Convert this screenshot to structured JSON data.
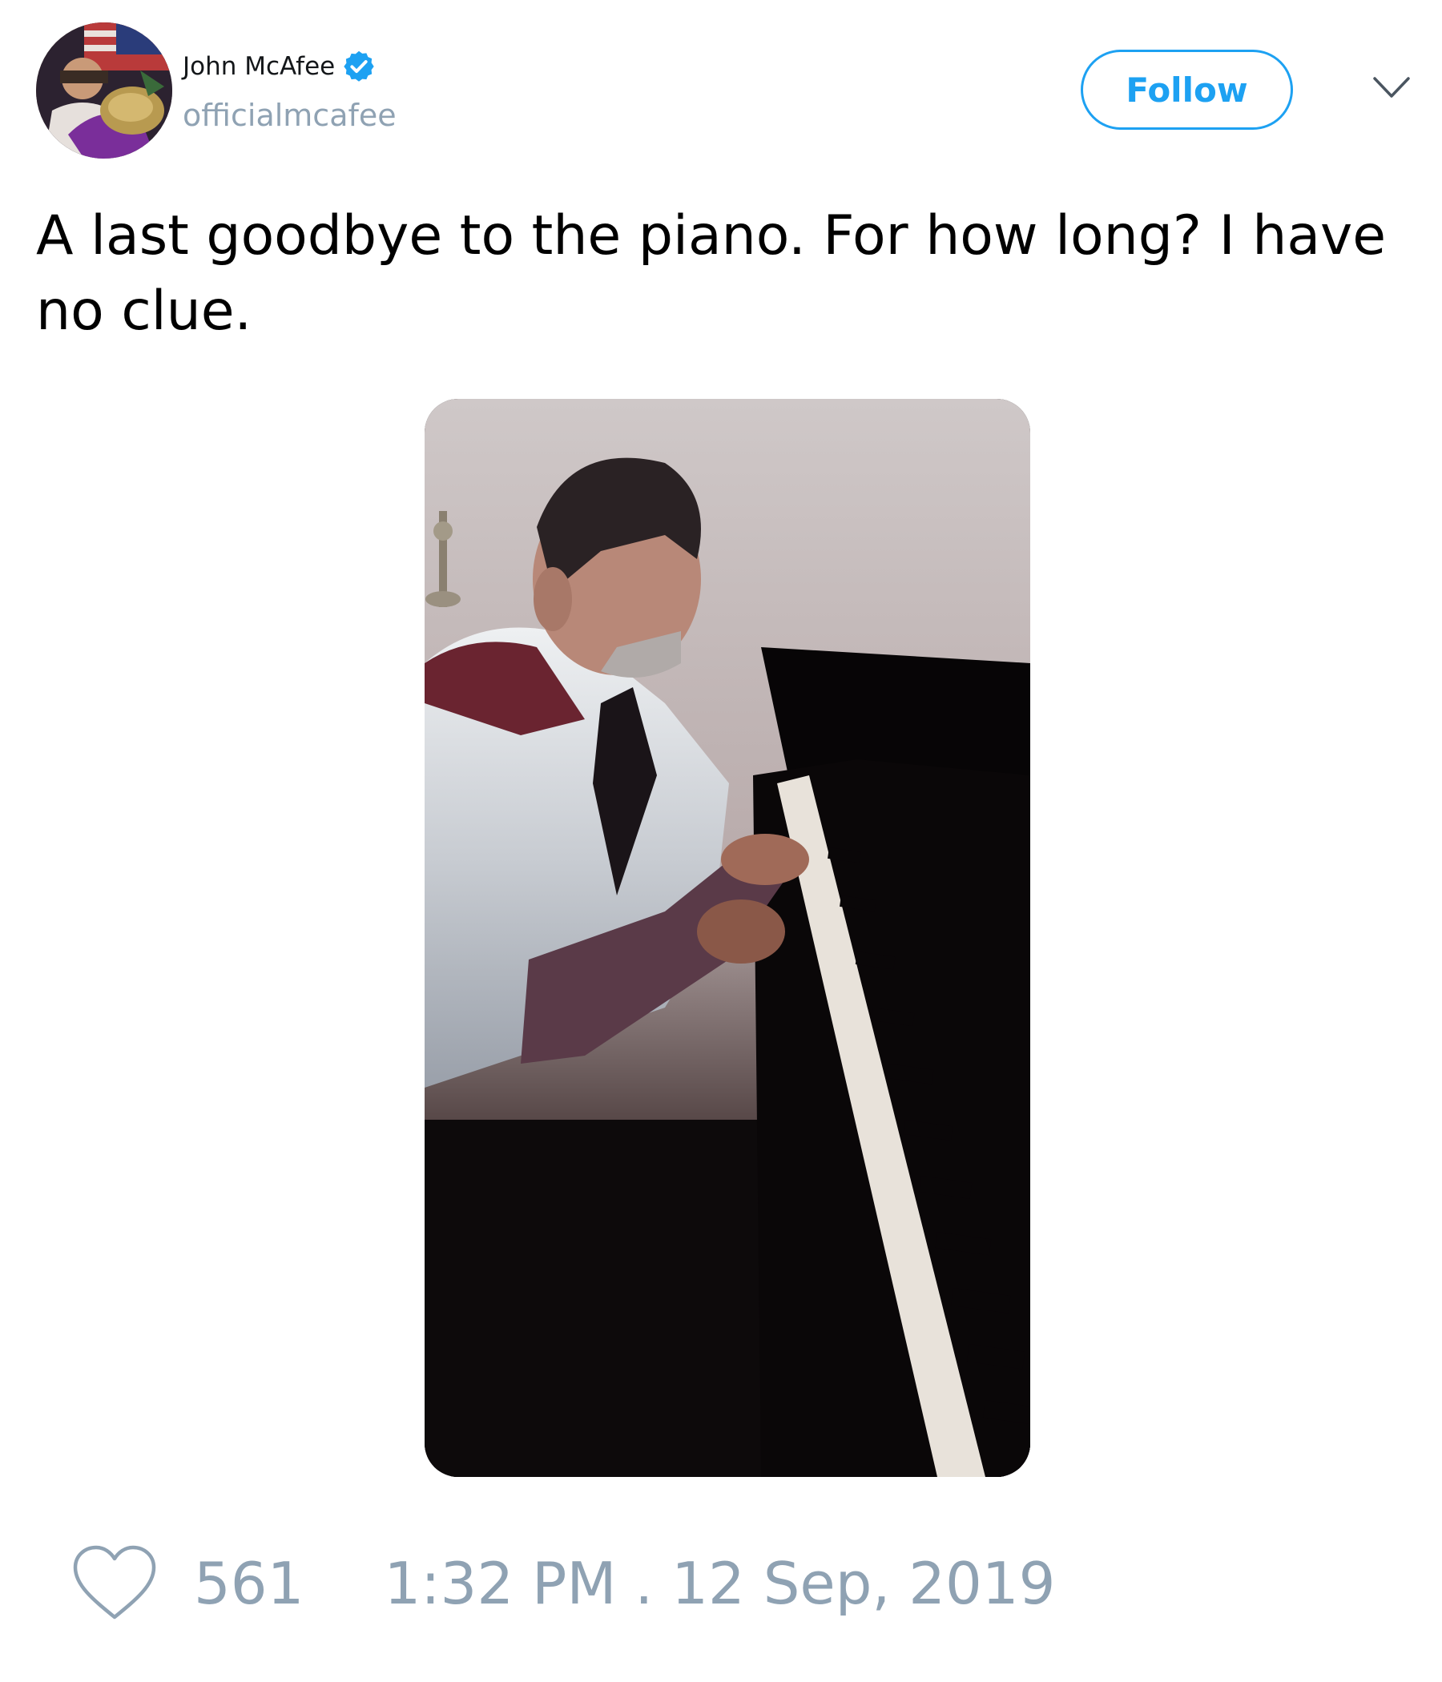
{
  "user": {
    "display_name": "John McAfee",
    "handle": "officialmcafee",
    "verified": true,
    "avatar_icon": "avatar-photo"
  },
  "actions": {
    "follow_label": "Follow",
    "menu_icon": "chevron-down-icon"
  },
  "tweet": {
    "text": "A last goodbye to the piano. For how long? I have no clue.",
    "media_description_icon": "video-thumbnail"
  },
  "footer": {
    "like_icon": "heart-icon",
    "like_count": "561",
    "timestamp": "1:32 PM . 12 Sep, 2019"
  },
  "colors": {
    "accent": "#1da1f2",
    "muted": "#8fa2b3",
    "text": "#14171a"
  }
}
